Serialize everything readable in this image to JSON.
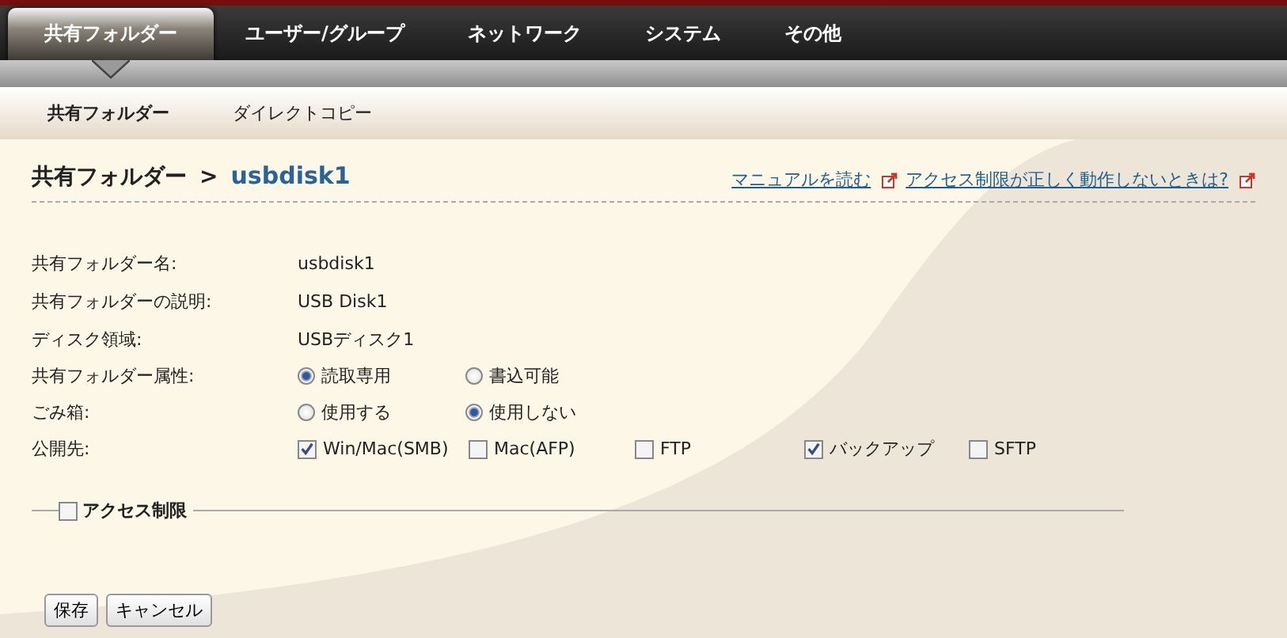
{
  "main_tabs": [
    {
      "label": "共有フォルダー",
      "selected": true
    },
    {
      "label": "ユーザー/グループ",
      "selected": false
    },
    {
      "label": "ネットワーク",
      "selected": false
    },
    {
      "label": "システム",
      "selected": false
    },
    {
      "label": "その他",
      "selected": false
    }
  ],
  "sub_tabs": [
    {
      "label": "共有フォルダー",
      "selected": true
    },
    {
      "label": "ダイレクトコピー",
      "selected": false
    }
  ],
  "breadcrumb": {
    "parent": "共有フォルダー",
    "separator": ">",
    "current": "usbdisk1"
  },
  "help_links": [
    "マニュアルを読む",
    "アクセス制限が正しく動作しないときは?"
  ],
  "fields": [
    {
      "kind": "text",
      "label": "共有フォルダー名:",
      "value": "usbdisk1"
    },
    {
      "kind": "text",
      "label": "共有フォルダーの説明:",
      "value": "USB Disk1"
    },
    {
      "kind": "text",
      "label": "ディスク領域:",
      "value": "USBディスク1"
    },
    {
      "kind": "radio",
      "label": "共有フォルダー属性:",
      "options": [
        {
          "label": "読取専用",
          "selected": true
        },
        {
          "label": "書込可能",
          "selected": false
        }
      ]
    },
    {
      "kind": "radio",
      "label": "ごみ箱:",
      "options": [
        {
          "label": "使用する",
          "selected": false
        },
        {
          "label": "使用しない",
          "selected": true
        }
      ]
    },
    {
      "kind": "checkbox",
      "label": "公開先:",
      "options": [
        {
          "label": "Win/Mac(SMB)",
          "checked": true
        },
        {
          "label": "Mac(AFP)",
          "checked": false
        },
        {
          "label": "FTP",
          "checked": false
        },
        {
          "label": "バックアップ",
          "checked": true
        },
        {
          "label": "SFTP",
          "checked": false
        }
      ]
    }
  ],
  "access_control": {
    "label": "アクセス制限",
    "checked": false
  },
  "buttons": [
    "保存",
    "キャンセル"
  ]
}
